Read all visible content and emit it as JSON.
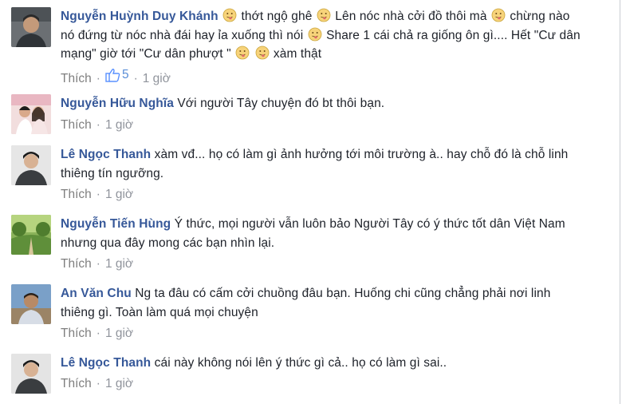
{
  "colors": {
    "author": "#365899",
    "meta": "#90949c",
    "like_count": "#598dd7"
  },
  "icons": {
    "emoticon": "tongue-face-emoticon-icon",
    "thumbs_up": "thumbs-up-icon"
  },
  "comments": [
    {
      "author": "Nguyễn Huỳnh Duy Khánh",
      "segments": [
        " thớt ngộ ghê ",
        " Lên nóc nhà cởi đồ thôi mà ",
        " chừng nào nó đứng từ nóc nhà đái hay ỉa xuống thì nói ",
        " Share 1 cái chả ra giống ôn gì.... Hết \"Cư dân mạng\" giờ tới \"Cư dân phượt \" ",
        " ",
        " xàm thật"
      ],
      "like_label": "Thích",
      "like_count": "5",
      "time": "1 giờ"
    },
    {
      "author": "Nguyễn Hữu Nghĩa",
      "text": "Với người Tây chuyện đó bt thôi bạn.",
      "like_label": "Thích",
      "time": "1 giờ"
    },
    {
      "author": "Lê Ngọc Thanh",
      "text": "xàm vđ... họ có làm gì ảnh hưởng tới môi trường à.. hay chỗ đó là chỗ linh thiêng tín ngưỡng.",
      "like_label": "Thích",
      "time": "1 giờ"
    },
    {
      "author": "Nguyễn Tiến Hùng",
      "text": "Ý thức, mọi người vẫn luôn bảo Người Tây có ý thức tốt dân Việt Nam nhưng qua đây mong các bạn nhìn lại.",
      "like_label": "Thích",
      "time": "1 giờ"
    },
    {
      "author": "An Văn Chu",
      "text": "Ng ta đâu có cấm cởi chuồng đâu bạn. Huống chi cũng chẳng phải nơi linh thiêng gì. Toàn làm quá mọi chuyện",
      "like_label": "Thích",
      "time": "1 giờ"
    },
    {
      "author": "Lê Ngọc Thanh",
      "text": "cái này không nói lên ý thức gì cả.. họ có làm gì sai..",
      "like_label": "Thích",
      "time": "1 giờ"
    }
  ]
}
